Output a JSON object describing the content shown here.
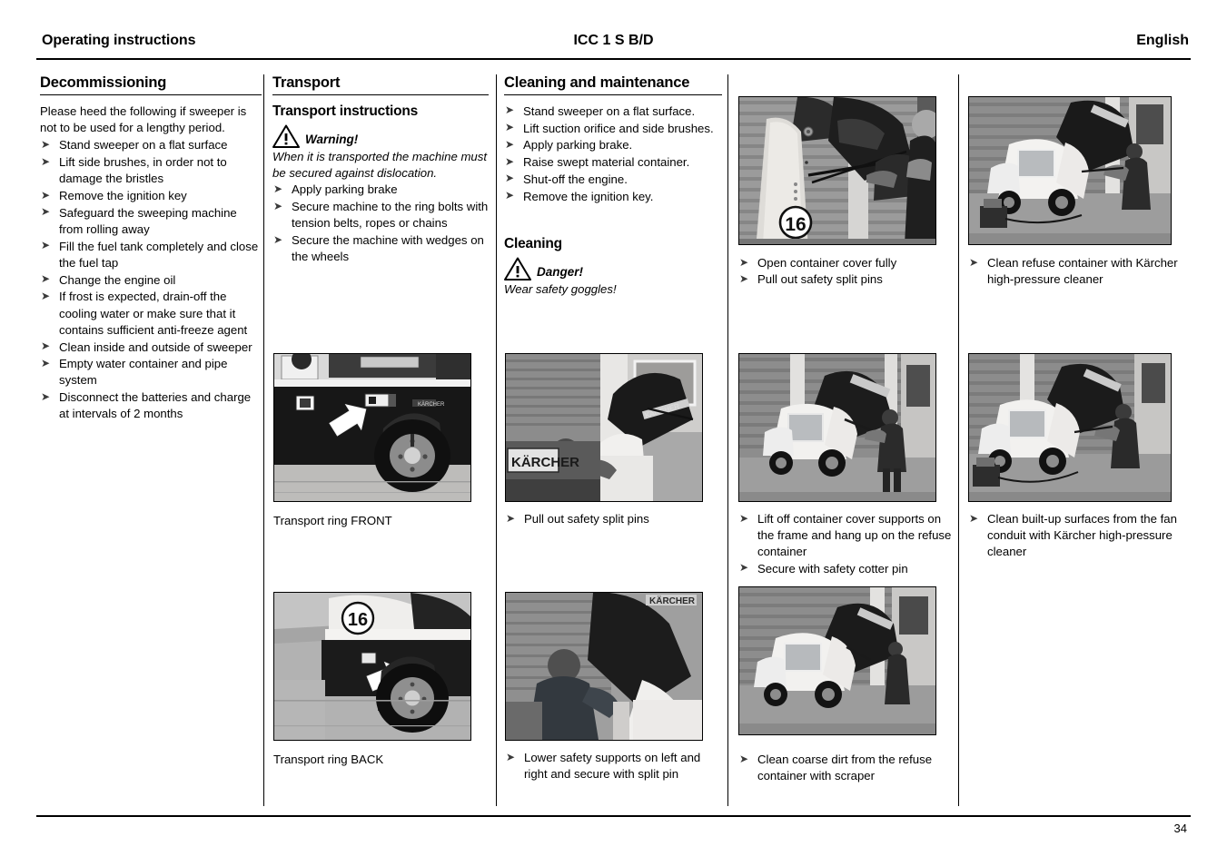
{
  "header": {
    "left": "Operating instructions",
    "center": "ICC 1 S B/D",
    "right": "English"
  },
  "footer": {
    "page_number": "34"
  },
  "columns": {
    "decommissioning": {
      "heading": "Decommissioning",
      "intro": "Please heed the following if sweeper is not to be used for a lengthy period.",
      "items": [
        "Stand sweeper on a flat surface",
        "Lift side brushes, in order not to damage the bristles",
        "Remove the ignition key",
        "Safeguard the sweeping machine from rolling away",
        "Fill the fuel tank completely and close the fuel tap",
        "Change the engine oil",
        "If frost is expected, drain-off the cooling water or make sure that it contains sufficient anti-freeze agent",
        "Clean inside and outside of sweeper",
        "Empty water container and pipe system",
        "Disconnect the batteries and charge at intervals of 2 months"
      ]
    },
    "transport": {
      "heading": "Transport",
      "subheading": "Transport instructions",
      "warning_label": "Warning!",
      "warning_text": "When it is transported the machine must be secured against dislocation.",
      "items": [
        "Apply parking brake",
        "Secure machine to the ring bolts with tension belts, ropes or chains",
        "Secure the machine with wedges on the wheels"
      ],
      "photo_front_caption": "Transport ring FRONT",
      "photo_back_caption": "Transport ring BACK",
      "photo_front_alt": "sweeper-side-view-transport-ring-front",
      "photo_back_alt": "sweeper-rear-wheel-transport-ring-back",
      "photo_back_badge": "16"
    },
    "cleaning_maintenance": {
      "heading": "Cleaning and maintenance",
      "items": [
        "Stand sweeper on a flat surface.",
        "Lift suction orifice and side brushes.",
        "Apply parking brake.",
        "Raise swept material container.",
        "Shut-off the engine.",
        "Remove the ignition key."
      ],
      "cleaning_heading": "Cleaning",
      "danger_label": "Danger!",
      "danger_text": "Wear safety goggles!",
      "photo_mid_alt": "worker-pulling-safety-split-pin-raised-container",
      "photo_mid_caption": "Pull out safety split pins",
      "photo_bottom_alt": "worker-lowering-safety-supports-split-pin",
      "photo_bottom_caption": "Lower safety supports on left and right and secure with split pin"
    },
    "container_column": {
      "photo_top_alt": "hand-pulling-split-pin-from-support-arm-marked-16",
      "photo_top_badge": "16",
      "photo_top_captions": [
        "Open container cover fully",
        "Pull out safety split pins"
      ],
      "photo_mid_alt": "worker-lifting-container-cover-support-off-frame",
      "photo_mid_captions": [
        "Lift off container cover supports on the frame and hang up on the refuse container",
        "Secure with safety cotter pin"
      ],
      "photo_bottom_alt": "worker-scraping-coarse-dirt-from-refuse-container",
      "photo_bottom_captions": [
        "Clean coarse dirt from the refuse container with scraper"
      ]
    },
    "pressure_cleaning_column": {
      "photo_top_alt": "worker-pressure-washing-refuse-container",
      "photo_top_captions": [
        "Clean refuse container with Kärcher high-pressure cleaner"
      ],
      "photo_bottom_alt": "worker-pressure-washing-fan-conduit",
      "photo_bottom_captions": [
        "Clean built-up surfaces from the fan conduit with Kärcher high-pressure cleaner"
      ]
    }
  },
  "icons": {
    "bullet": "➤",
    "warning_triangle": "warning-triangle-icon"
  }
}
